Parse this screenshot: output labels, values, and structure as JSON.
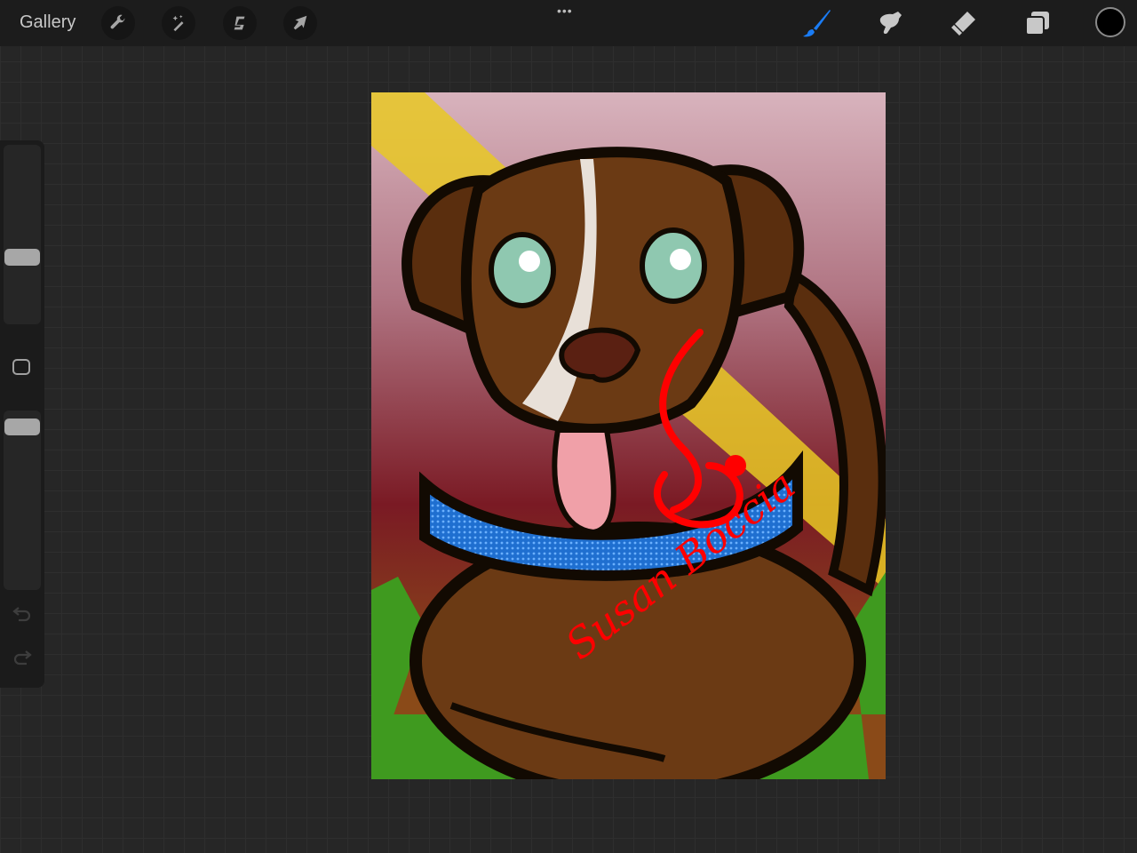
{
  "topbar": {
    "gallery_label": "Gallery",
    "left_tools": [
      "wrench-icon",
      "magic-wand-icon",
      "selection-s-icon",
      "transform-arrow-icon"
    ],
    "more_label": "•••",
    "right_tools": [
      "brush-icon",
      "smudge-icon",
      "eraser-icon",
      "layers-icon"
    ],
    "active_tool": "brush",
    "active_color": "#000000",
    "accent_color": "#1a7cf5"
  },
  "sidebar": {
    "brush_size": 0.36,
    "opacity": 0.95,
    "undo_icon": "undo-icon",
    "redo_icon": "redo-icon"
  },
  "artwork": {
    "signature": "Susan Boccia"
  }
}
